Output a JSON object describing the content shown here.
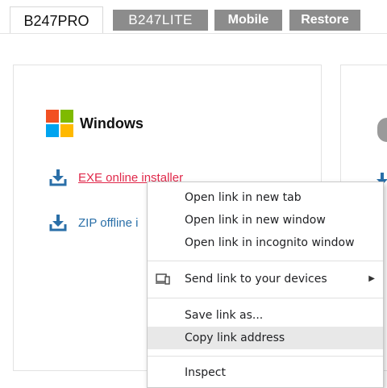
{
  "tabs": [
    {
      "label": "B247PRO"
    },
    {
      "label": "B247LITE"
    },
    {
      "label": "Mobile"
    },
    {
      "label": "Restore"
    }
  ],
  "os": {
    "name": "Windows",
    "logo_colors": [
      "#f25022",
      "#7fba00",
      "#00a4ef",
      "#ffb900"
    ]
  },
  "downloads": [
    {
      "label": "EXE online installer",
      "icon": "download-icon"
    },
    {
      "label": "ZIP offline i",
      "icon": "download-icon"
    }
  ],
  "context_menu": {
    "items": [
      {
        "label": "Open link in new tab"
      },
      {
        "label": "Open link in new window"
      },
      {
        "label": "Open link in incognito window"
      },
      {
        "label": "Send link to your devices",
        "icon": "devices-icon",
        "submenu": true
      },
      {
        "label": "Save link as..."
      },
      {
        "label": "Copy link address",
        "selected": true
      },
      {
        "label": "Inspect"
      }
    ]
  },
  "colors": {
    "accent_blue": "#2a6fa8",
    "link_hover_red": "#e0284a",
    "tab_inactive": "#8c8c8c"
  }
}
